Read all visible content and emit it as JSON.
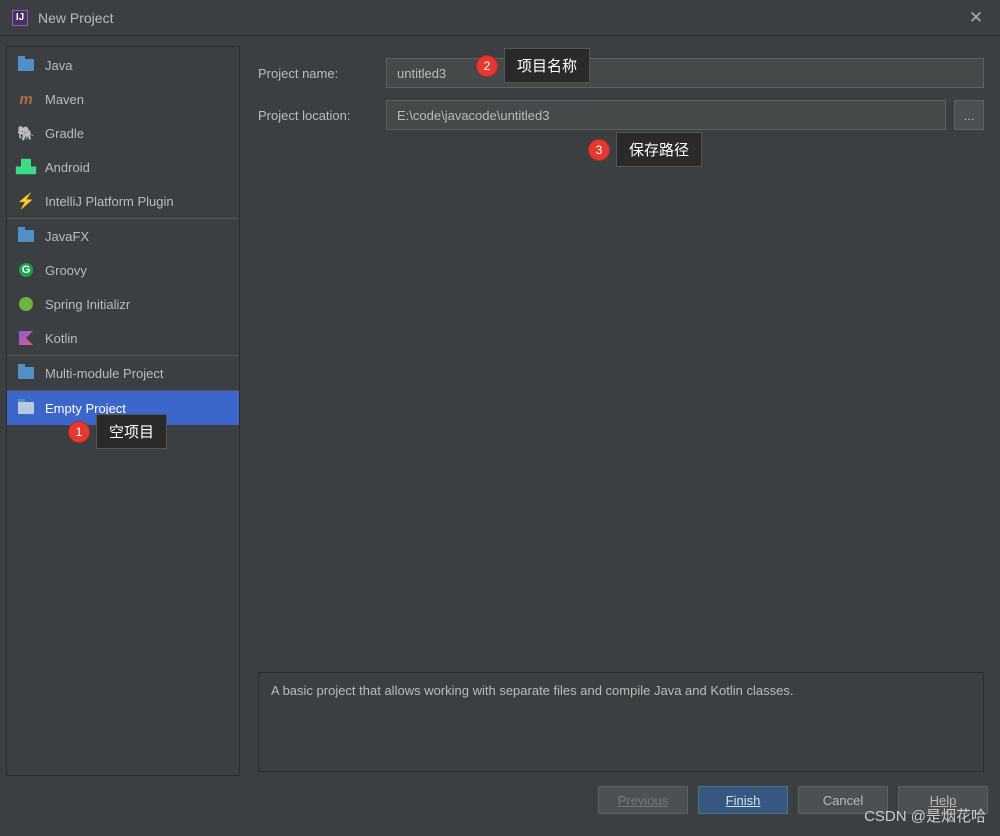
{
  "window": {
    "title": "New Project",
    "close_glyph": "✕"
  },
  "sidebar": {
    "groups": [
      [
        "Java",
        "Maven",
        "Gradle",
        "Android",
        "IntelliJ Platform Plugin"
      ],
      [
        "JavaFX",
        "Groovy",
        "Spring Initializr",
        "Kotlin"
      ],
      [
        "Multi-module Project"
      ],
      [
        "Empty Project"
      ]
    ],
    "selected": "Empty Project"
  },
  "form": {
    "name_label": "Project name:",
    "name_value": "untitled3",
    "location_label": "Project location:",
    "location_value": "E:\\code\\javacode\\untitled3",
    "browse_label": "..."
  },
  "description": "A basic project that allows working with separate files and compile Java and Kotlin classes.",
  "buttons": {
    "previous": "Previous",
    "finish": "Finish",
    "cancel": "Cancel",
    "help": "Help"
  },
  "annotations": {
    "a1": {
      "num": "1",
      "label": "空项目"
    },
    "a2": {
      "num": "2",
      "label": "项目名称"
    },
    "a3": {
      "num": "3",
      "label": "保存路径"
    }
  },
  "watermark": "CSDN @是烟花哈"
}
